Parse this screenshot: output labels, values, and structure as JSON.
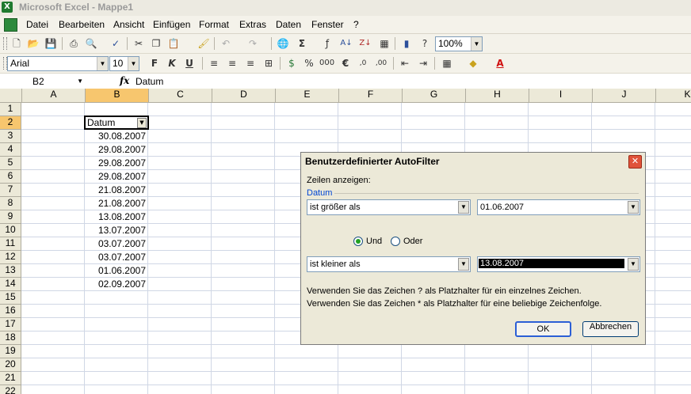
{
  "titlebar": {
    "title": "Microsoft Excel - Mappe1",
    "icon": "excel-icon"
  },
  "menu": [
    "Datei",
    "Bearbeiten",
    "Ansicht",
    "Einfügen",
    "Format",
    "Extras",
    "Daten",
    "Fenster",
    "?"
  ],
  "toolbar": {
    "zoom": "100%"
  },
  "format_toolbar": {
    "font": "Arial",
    "size": "10",
    "bold": "F",
    "italic": "K",
    "underline": "U",
    "percent": "%",
    "thousands": "000",
    "euro": "€"
  },
  "formula_bar": {
    "name_box": "B2",
    "fx": "fx",
    "value": "Datum"
  },
  "grid": {
    "columns": [
      "A",
      "B",
      "C",
      "D",
      "E",
      "F",
      "G",
      "H",
      "I",
      "J",
      "K"
    ],
    "rows": [
      "1",
      "2",
      "3",
      "4",
      "5",
      "6",
      "7",
      "8",
      "9",
      "10",
      "11",
      "12",
      "13",
      "14",
      "15",
      "16",
      "17",
      "18",
      "19",
      "20",
      "21",
      "22"
    ],
    "header_cell": "Datum",
    "dates": [
      "30.08.2007",
      "29.08.2007",
      "29.08.2007",
      "29.08.2007",
      "21.08.2007",
      "21.08.2007",
      "13.08.2007",
      "13.07.2007",
      "03.07.2007",
      "03.07.2007",
      "01.06.2007",
      "02.09.2007"
    ]
  },
  "dialog": {
    "title": "Benutzerdefinierter AutoFilter",
    "show_rows": "Zeilen anzeigen:",
    "field": "Datum",
    "cond1_operator": "ist größer als",
    "cond1_value": "01.06.2007",
    "and_label": "Und",
    "or_label": "Oder",
    "cond2_operator": "ist kleiner als",
    "cond2_value": "13.08.2007",
    "hint1": "Verwenden Sie das Zeichen ? als Platzhalter für ein einzelnes Zeichen.",
    "hint2": "Verwenden Sie das Zeichen * als Platzhalter für eine beliebige Zeichenfolge.",
    "ok": "OK",
    "cancel": "Abbrechen"
  }
}
